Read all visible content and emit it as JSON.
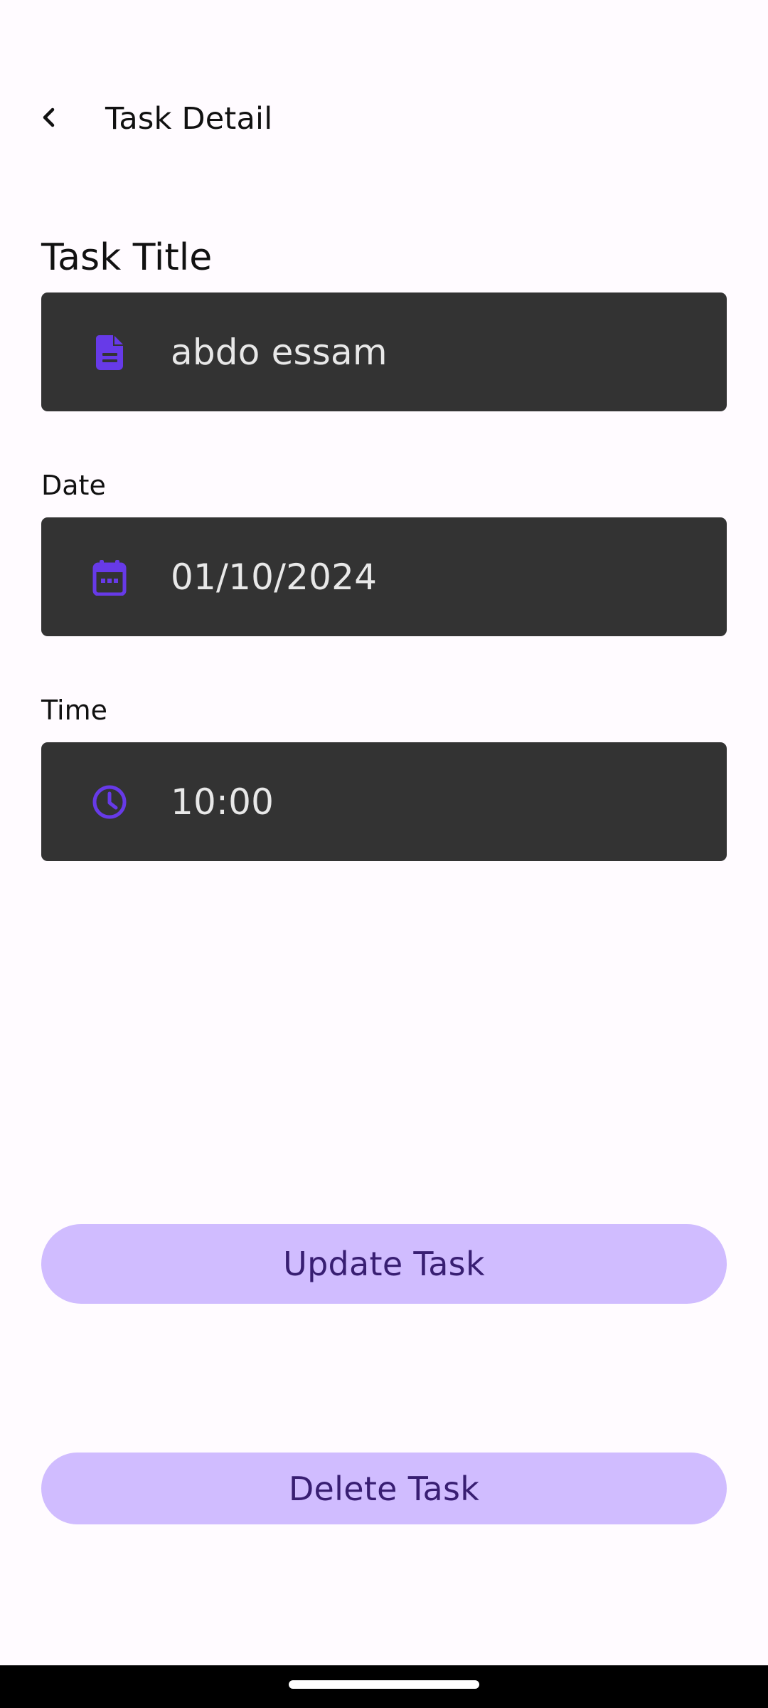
{
  "app_bar": {
    "title": "Task Detail",
    "back_icon": "chevron-left-icon"
  },
  "form": {
    "task_title_label": "Task Title",
    "task_title_value": "abdo essam",
    "task_title_icon": "document-icon",
    "date_label": "Date",
    "date_value": "01/10/2024",
    "date_icon": "calendar-icon",
    "time_label": "Time",
    "time_value": "10:00",
    "time_icon": "clock-icon"
  },
  "actions": {
    "update_label": "Update Task",
    "delete_label": "Delete Task"
  },
  "colors": {
    "background": "#fffbff",
    "field_background": "#333333",
    "field_text": "#e8e8e8",
    "icon": "#673ae8",
    "button_background": "#d0bcff",
    "button_text": "#381e72",
    "navigation_bar": "#000000"
  }
}
